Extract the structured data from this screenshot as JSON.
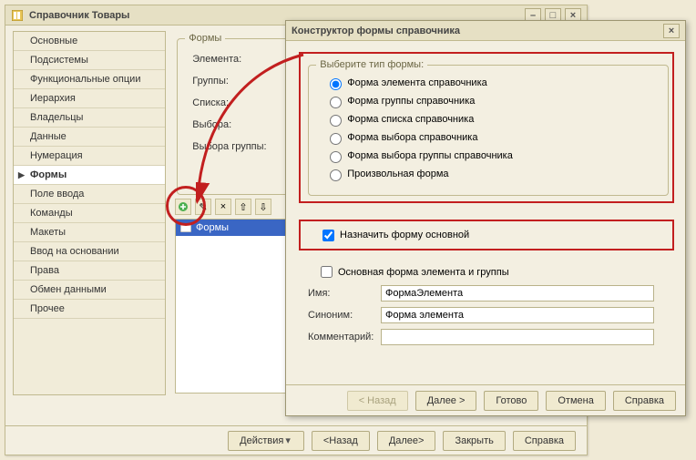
{
  "main": {
    "title": "Справочник Товары",
    "nav": [
      "Основные",
      "Подсистемы",
      "Функциональные опции",
      "Иерархия",
      "Владельцы",
      "Данные",
      "Нумерация",
      "Формы",
      "Поле ввода",
      "Команды",
      "Макеты",
      "Ввод на основании",
      "Права",
      "Обмен данными",
      "Прочее"
    ],
    "nav_active_index": 7,
    "forms_group_title": "Формы",
    "form_slots": [
      "Элемента:",
      "Группы:",
      "Списка:",
      "Выбора:",
      "Выбора группы:"
    ],
    "tree_item": "Формы",
    "footer": {
      "actions": "Действия",
      "back": "<Назад",
      "next": "Далее>",
      "close": "Закрыть",
      "help": "Справка"
    }
  },
  "dialog": {
    "title": "Конструктор формы справочника",
    "type_group_title": "Выберите тип формы:",
    "radios": [
      "Форма элемента справочника",
      "Форма группы справочника",
      "Форма списка справочника",
      "Форма выбора справочника",
      "Форма выбора группы справочника",
      "Произвольная форма"
    ],
    "radio_selected_index": 0,
    "assign_main_label": "Назначить форму основной",
    "assign_main_checked": true,
    "main_and_group_label": "Основная форма элемента и группы",
    "fields": {
      "name_label": "Имя:",
      "name_value": "ФормаЭлемента",
      "syn_label": "Синоним:",
      "syn_value": "Форма элемента",
      "comment_label": "Комментарий:",
      "comment_value": ""
    },
    "buttons": {
      "back": "< Назад",
      "next": "Далее >",
      "ready": "Готово",
      "cancel": "Отмена",
      "help": "Справка"
    }
  },
  "colors": {
    "accent_red": "#c21f1f"
  }
}
